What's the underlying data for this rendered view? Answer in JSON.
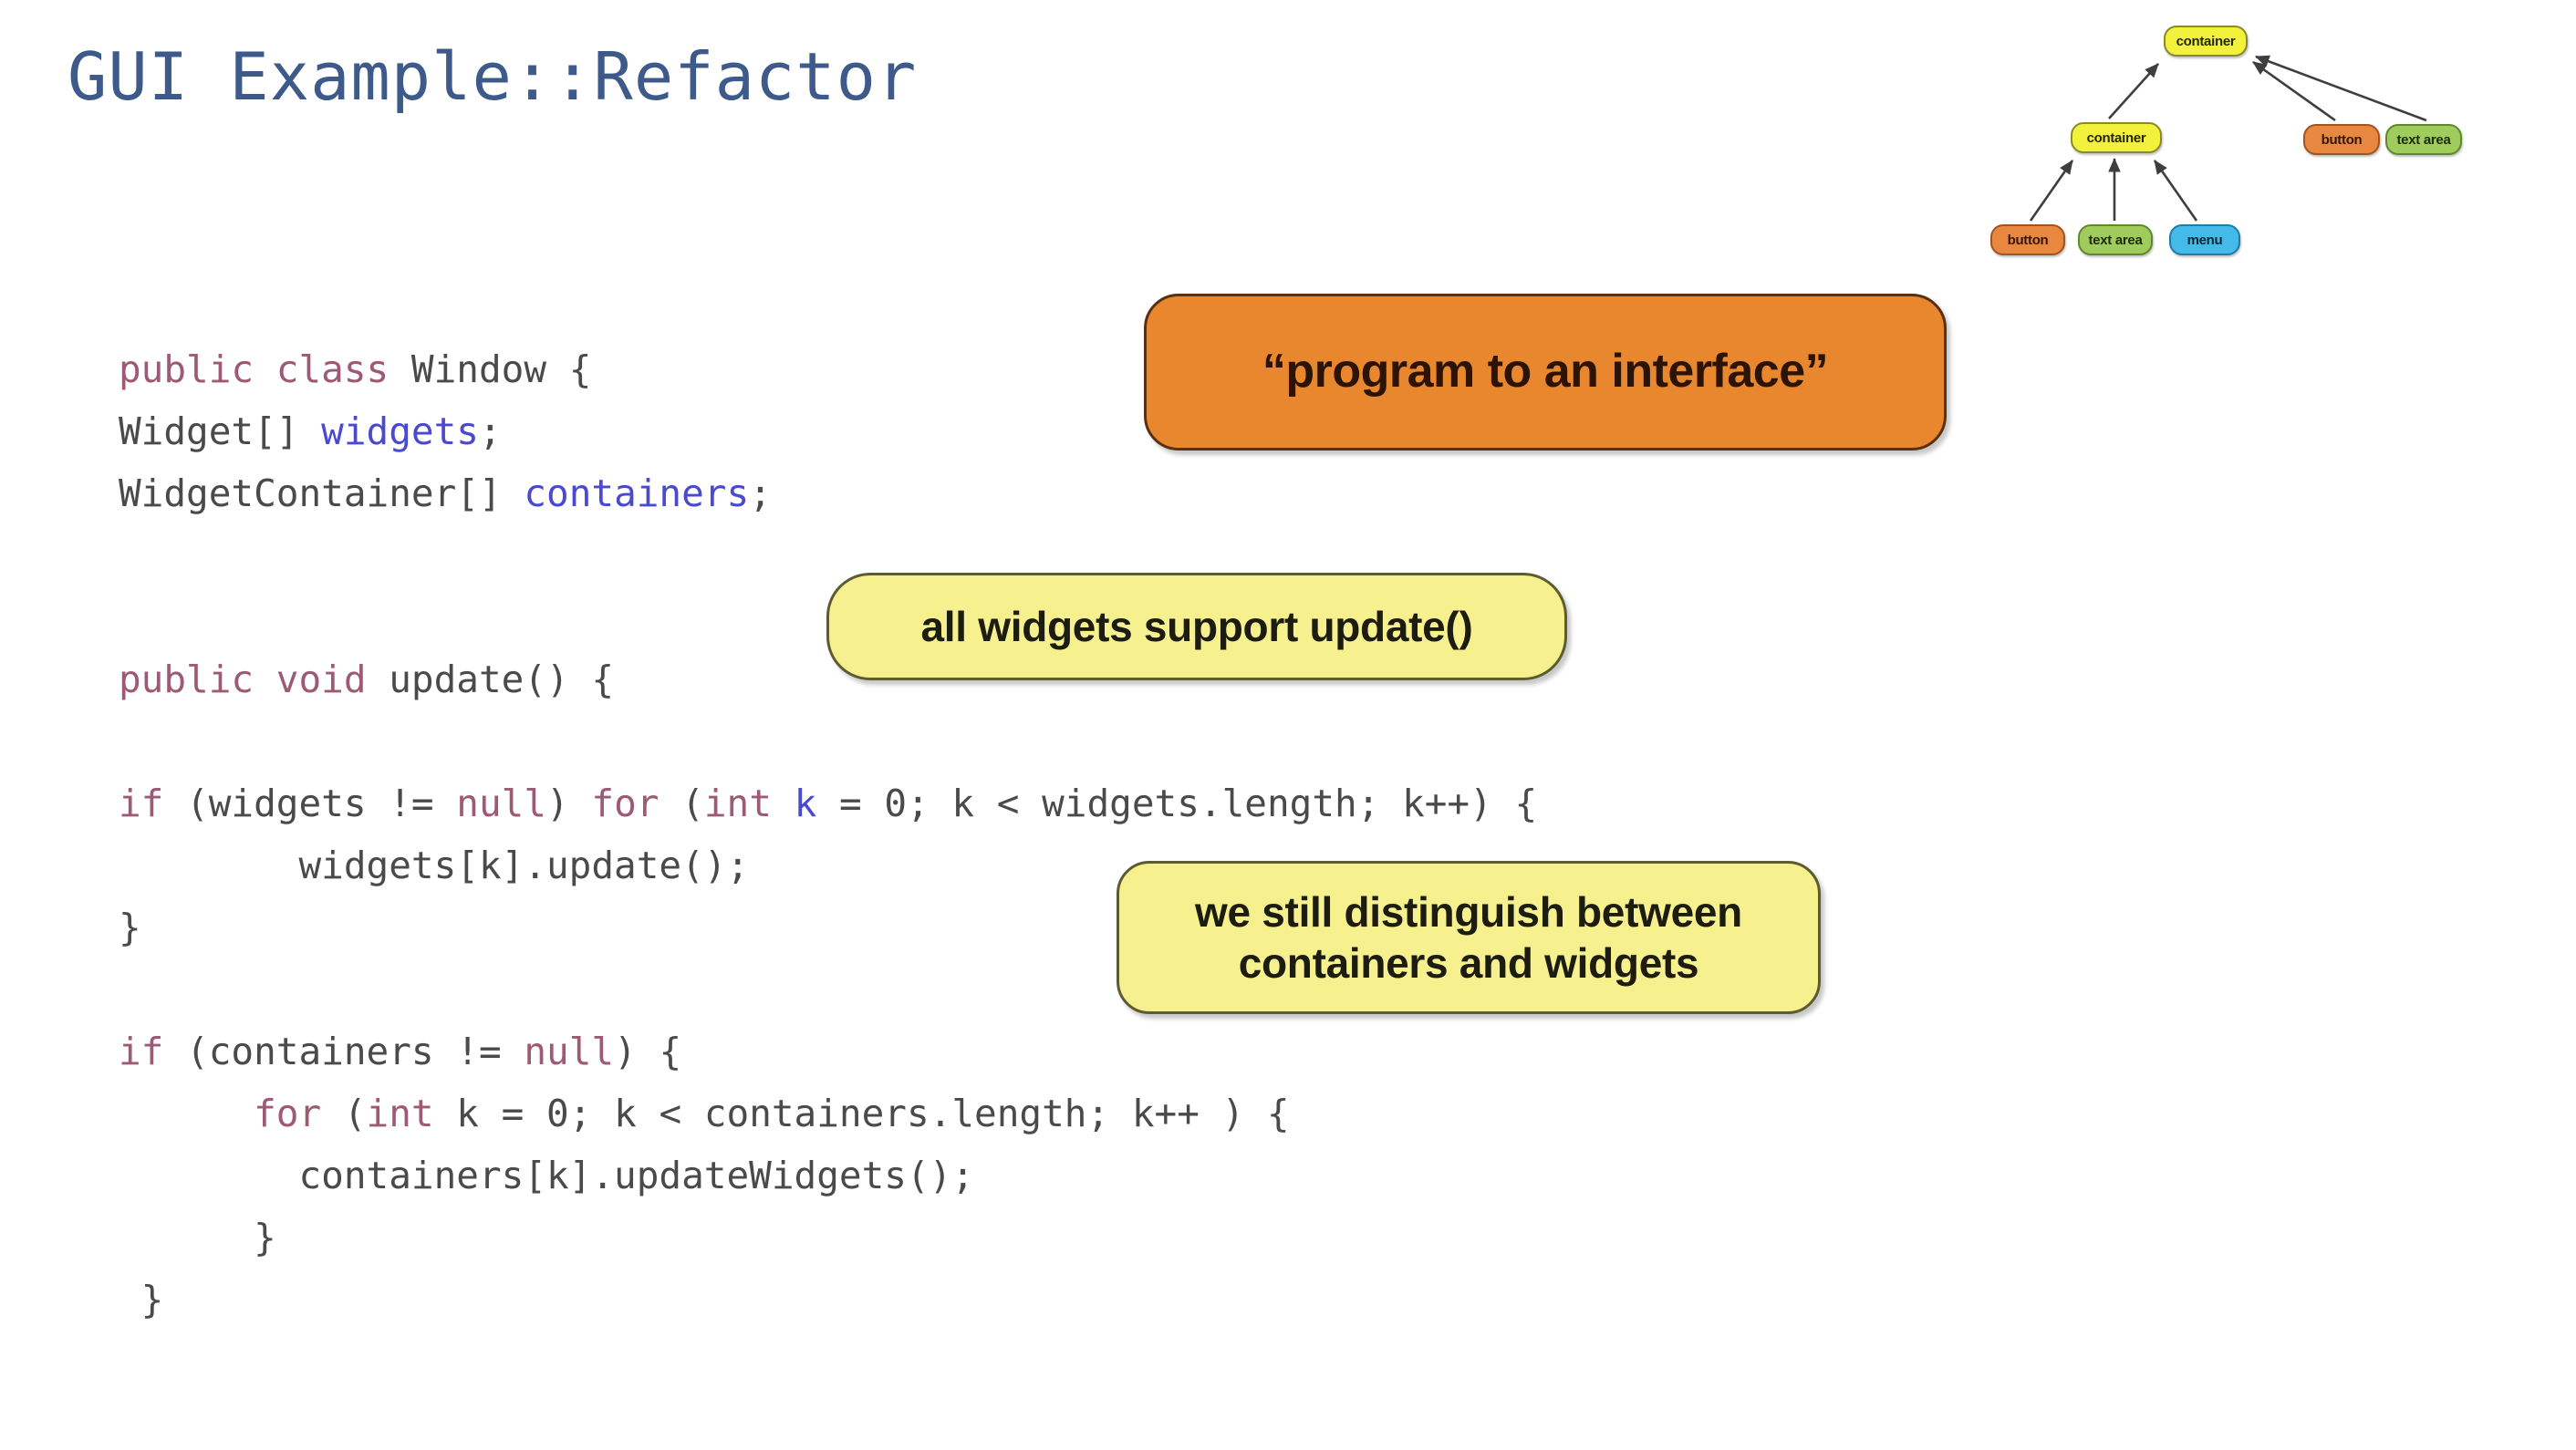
{
  "slide": {
    "title": "GUI Example::Refactor",
    "background_color": "#ffffff",
    "title_color": "#3d5a8a"
  },
  "code": {
    "language": "java",
    "lines": [
      [
        {
          "text": "public class ",
          "kind": "keyword"
        },
        {
          "text": "Window {",
          "kind": "plain"
        }
      ],
      [
        {
          "text": "Widget[] ",
          "kind": "plain"
        },
        {
          "text": "widgets",
          "kind": "identifier"
        },
        {
          "text": ";",
          "kind": "plain"
        }
      ],
      [
        {
          "text": "WidgetContainer[] ",
          "kind": "plain"
        },
        {
          "text": "containers",
          "kind": "identifier"
        },
        {
          "text": ";",
          "kind": "plain"
        }
      ],
      [],
      [],
      [
        {
          "text": "public void ",
          "kind": "keyword"
        },
        {
          "text": "update() {",
          "kind": "plain"
        }
      ],
      [],
      [
        {
          "text": "if ",
          "kind": "keyword"
        },
        {
          "text": "(widgets != ",
          "kind": "plain"
        },
        {
          "text": "null",
          "kind": "keyword"
        },
        {
          "text": ") ",
          "kind": "plain"
        },
        {
          "text": "for ",
          "kind": "keyword"
        },
        {
          "text": "(",
          "kind": "plain"
        },
        {
          "text": "int ",
          "kind": "keyword"
        },
        {
          "text": "k",
          "kind": "identifier"
        },
        {
          "text": " = 0; k < widgets.length; k++) {",
          "kind": "plain"
        }
      ],
      [
        {
          "text": "        widgets[k].update();",
          "kind": "plain"
        }
      ],
      [
        {
          "text": "}",
          "kind": "plain"
        }
      ],
      [],
      [
        {
          "text": "if ",
          "kind": "keyword"
        },
        {
          "text": "(containers != ",
          "kind": "plain"
        },
        {
          "text": "null",
          "kind": "keyword"
        },
        {
          "text": ") {",
          "kind": "plain"
        }
      ],
      [
        {
          "text": "      ",
          "kind": "plain"
        },
        {
          "text": "for ",
          "kind": "keyword"
        },
        {
          "text": "(",
          "kind": "plain"
        },
        {
          "text": "int ",
          "kind": "keyword"
        },
        {
          "text": "k = 0; k < containers.length; k++ ) {",
          "kind": "plain"
        }
      ],
      [
        {
          "text": "        containers[k].updateWidgets();",
          "kind": "plain"
        }
      ],
      [
        {
          "text": "      }",
          "kind": "plain"
        }
      ],
      [
        {
          "text": " }",
          "kind": "plain"
        }
      ]
    ]
  },
  "callouts": [
    {
      "id": "interface",
      "text": "“program to an interface”",
      "color": "#E8872E",
      "text_color": "#2b1405"
    },
    {
      "id": "update",
      "text": "all widgets support update()",
      "color": "#F6F08E",
      "text_color": "#1c1c10"
    },
    {
      "id": "distinguish",
      "line1": "we still distinguish between",
      "line2": "containers and widgets",
      "color": "#F6F08E",
      "text_color": "#1c1c10"
    }
  ],
  "tree": {
    "nodes": {
      "root": {
        "label": "container",
        "color": "#F2F23C"
      },
      "container2": {
        "label": "container",
        "color": "#F2F23C"
      },
      "button_right": {
        "label": "button",
        "color": "#E8873F"
      },
      "textarea_right": {
        "label": "text area",
        "color": "#9FCC5C"
      },
      "button_left": {
        "label": "button",
        "color": "#E8873F"
      },
      "textarea_left": {
        "label": "text area",
        "color": "#9FCC5C"
      },
      "menu_left": {
        "label": "menu",
        "color": "#45B9E8"
      }
    },
    "edges": [
      {
        "from": "container2",
        "to": "root"
      },
      {
        "from": "button_right",
        "to": "root"
      },
      {
        "from": "textarea_right",
        "to": "root"
      },
      {
        "from": "button_left",
        "to": "container2"
      },
      {
        "from": "textarea_left",
        "to": "container2"
      },
      {
        "from": "menu_left",
        "to": "container2"
      }
    ]
  }
}
